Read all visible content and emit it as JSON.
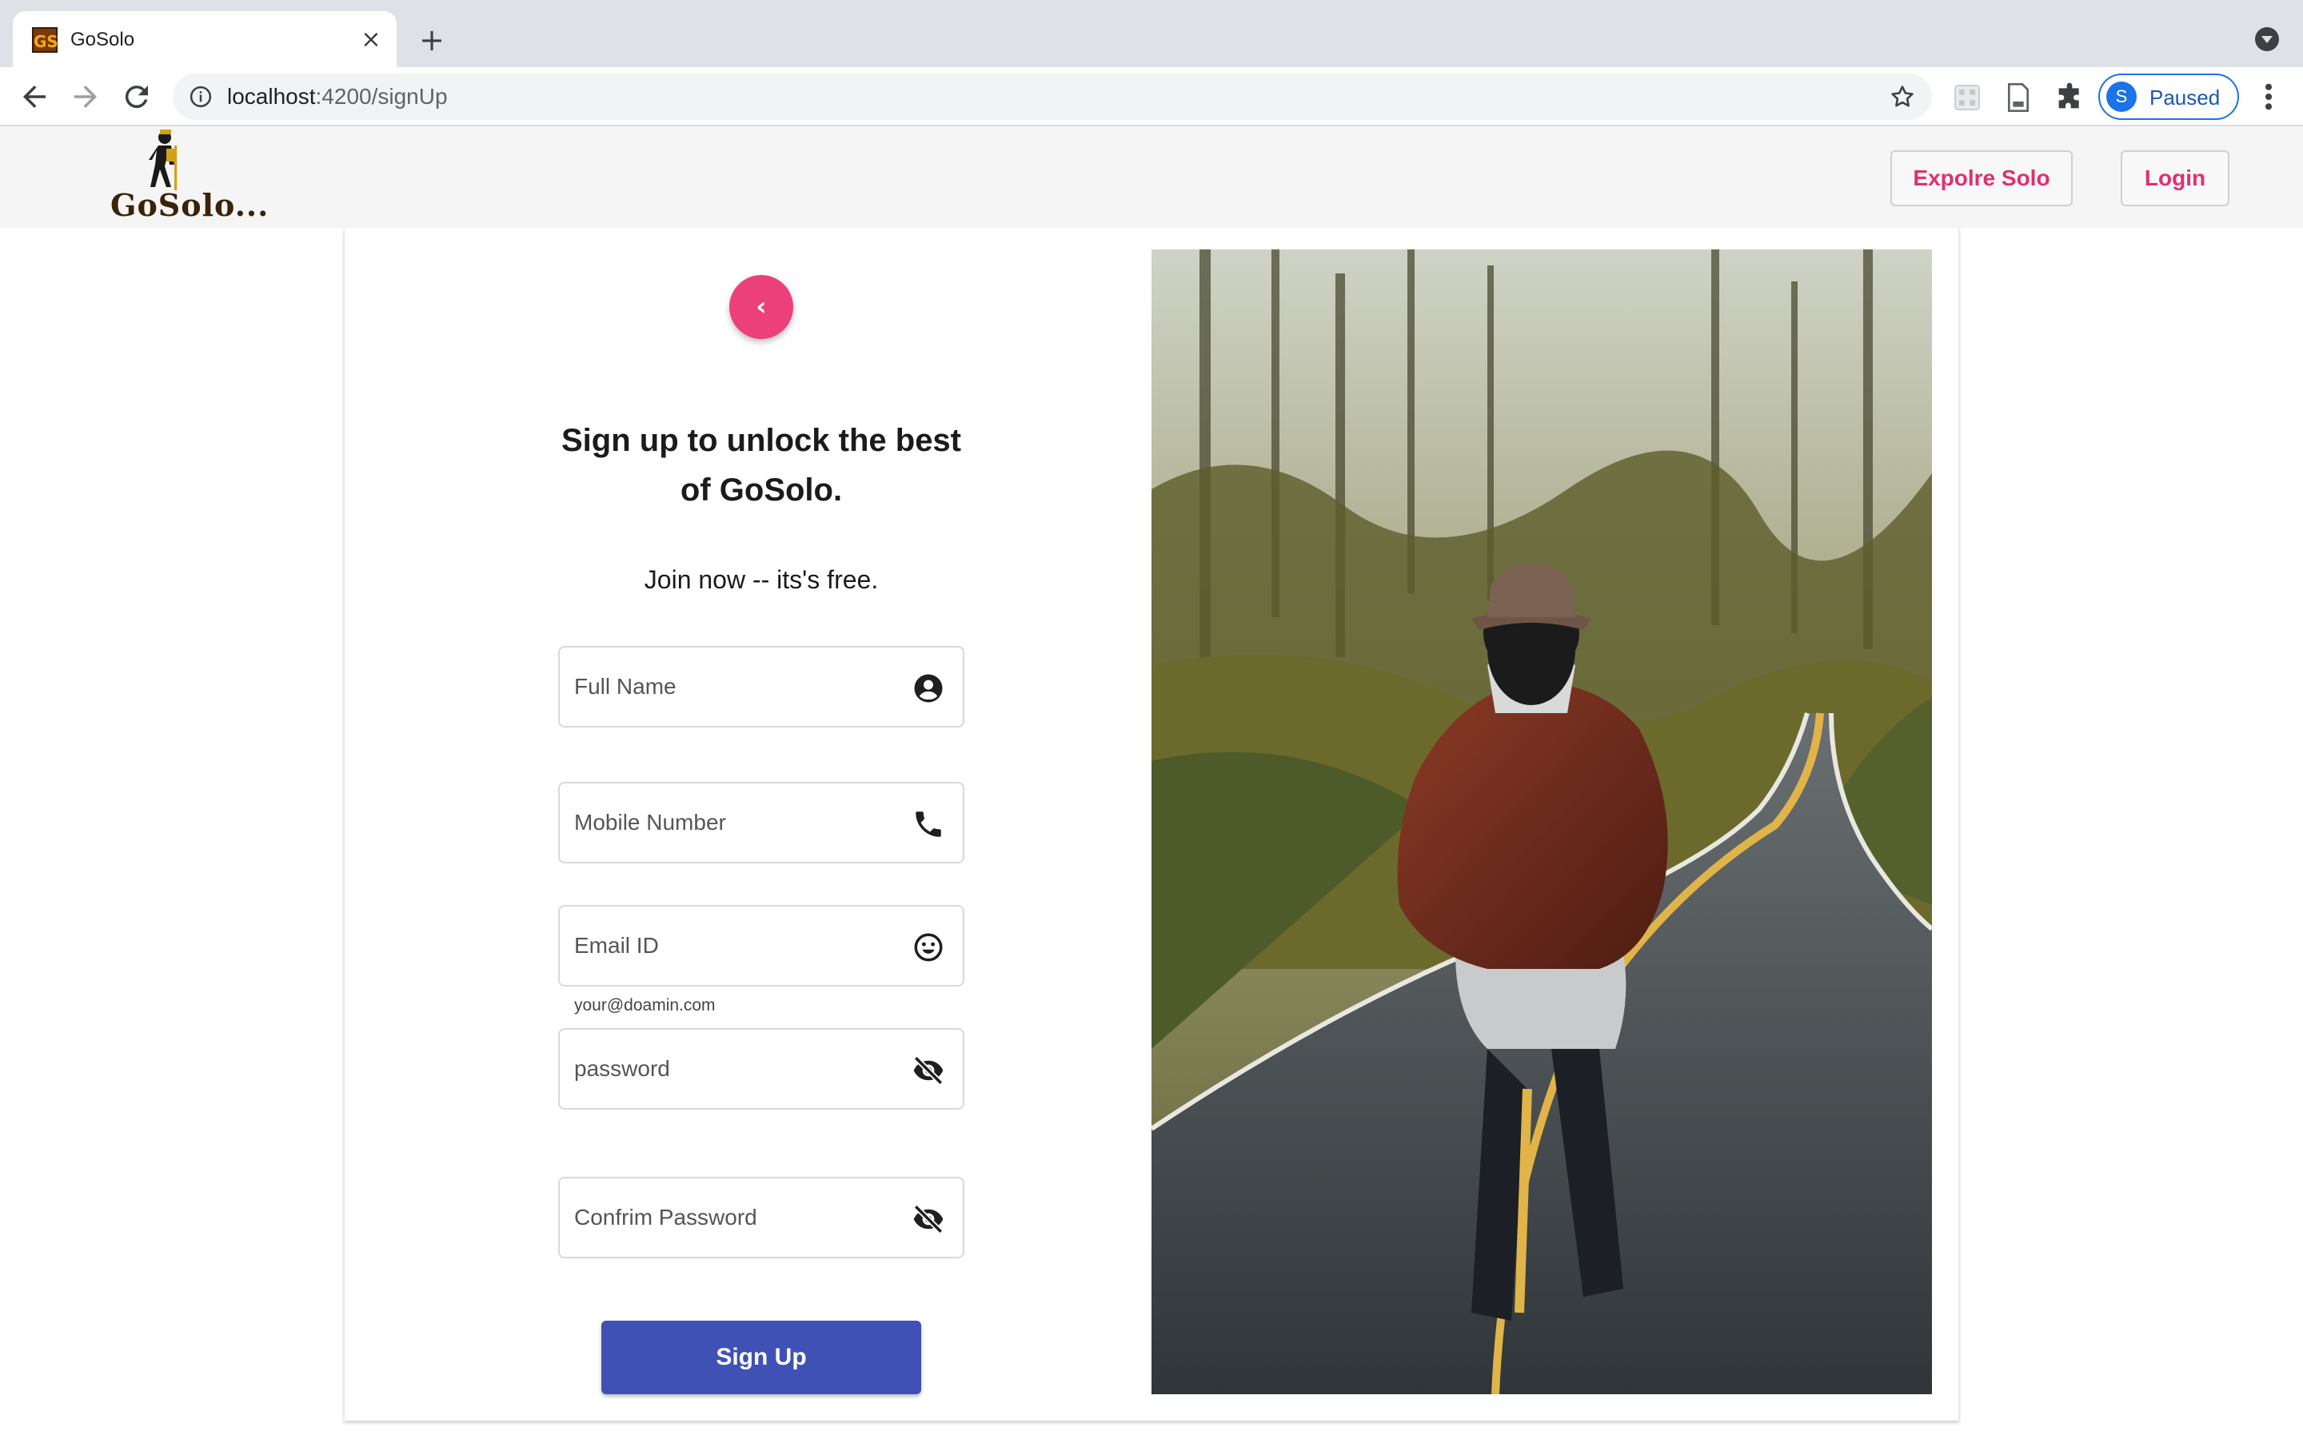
{
  "browser": {
    "tab": {
      "favicon_text": "GS",
      "title": "GoSolo",
      "close_glyph": "×"
    },
    "new_tab_glyph": "+",
    "address": {
      "host": "localhost",
      "rest": ":4200/signUp"
    },
    "profile": {
      "initial": "S",
      "label": "Paused"
    },
    "icons": [
      "back-arrow-icon",
      "forward-arrow-icon",
      "reload-icon",
      "info-icon",
      "bookmark-star-icon",
      "extension-icon",
      "reading-list-icon",
      "puzzle-icon",
      "kebab-menu-icon",
      "tab-search-icon"
    ]
  },
  "header": {
    "logo_text": "GoSolo...",
    "explore_label": "Expolre Solo",
    "login_label": "Login"
  },
  "form": {
    "back_glyph": "‹",
    "headline_line1": "Sign up to unlock the best",
    "headline_line2": "of GoSolo.",
    "subline": "Join now -- its's free.",
    "full_name_placeholder": "Full Name",
    "mobile_placeholder": "Mobile Number",
    "email_placeholder": "Email ID",
    "email_hint": "your@doamin.com",
    "password_placeholder": "password",
    "confirm_placeholder": "Confrim Password",
    "submit_label": "Sign Up",
    "field_icons": [
      "account-circle-icon",
      "phone-icon",
      "smiley-icon",
      "visibility-off-icon",
      "visibility-off-icon"
    ]
  },
  "colors": {
    "accent_pink": "#ec407a",
    "header_button_text": "#e0306f",
    "primary_button": "#3f51b5",
    "profile_blue": "#1a73e8"
  }
}
